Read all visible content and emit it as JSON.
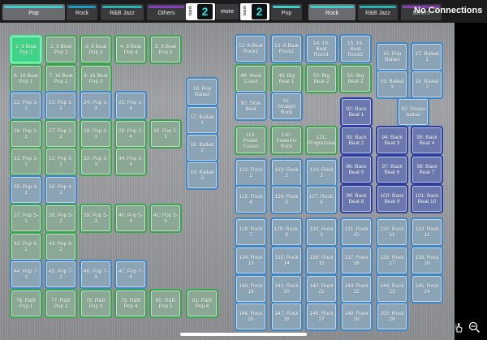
{
  "topbar": {
    "left_tabs": [
      {
        "label": "Pop",
        "active": true,
        "color": "#3bd0cc"
      },
      {
        "label": "Rock",
        "active": false,
        "color": "#1a9fc4"
      },
      {
        "label": "R&B Jazz",
        "active": false,
        "color": "#27b3b3"
      },
      {
        "label": "Others",
        "active": false,
        "color": "#8a3dbd"
      }
    ],
    "bank_left": {
      "label": "bank",
      "number": "2"
    },
    "more_label": "more",
    "bank_right": {
      "label": "bank",
      "number": "2"
    },
    "right_tabs": [
      {
        "label": "Pop",
        "active": false,
        "color": "#3bd0cc"
      },
      {
        "label": "Rock",
        "active": true,
        "color": "#3bd0cc"
      },
      {
        "label": "R&B Jazz",
        "active": false,
        "color": "#27b3b3"
      },
      {
        "label": "Others",
        "active": false,
        "color": "#8a3dbd"
      }
    ],
    "status": "No Connections"
  },
  "icons": {
    "gesture": "hand-pointer-icon",
    "zoom": "zoom-out-icon"
  },
  "colors": {
    "green": "#35a74a",
    "blue": "#3d86c8",
    "navy": "#2c3ea4",
    "selected": "#3ed387"
  },
  "left_pads": [
    {
      "label": "1: 8 Beat Pop 1",
      "tone": "sel"
    },
    {
      "label": "2: 8 Beat Pop 2",
      "tone": "g"
    },
    {
      "label": "3: 8 Beat Pop 3",
      "tone": "g"
    },
    {
      "label": "4: 8 Beat Pop 4",
      "tone": "g"
    },
    {
      "label": "5: 8 Beat Pop 5",
      "tone": "g"
    },
    {
      "label": "6: 16 Beat Pop 1",
      "tone": "g"
    },
    {
      "label": "7: 16 Beat Pop 2",
      "tone": "g"
    },
    {
      "label": "8: 16 Beat Pop 3",
      "tone": "g"
    },
    {
      "label": "18: Pop Ballad",
      "tone": "b"
    },
    {
      "label": "22: Pop 1-1",
      "tone": "b"
    },
    {
      "label": "23: Pop 1-2",
      "tone": "b"
    },
    {
      "label": "24: Pop 1-3",
      "tone": "b"
    },
    {
      "label": "25: Pop 1-4",
      "tone": "b"
    },
    {
      "label": "17: Ballad 1",
      "tone": "b"
    },
    {
      "label": "26: Pop 2-1",
      "tone": "g"
    },
    {
      "label": "27: Pop 2-2",
      "tone": "g"
    },
    {
      "label": "28: Pop 2-3",
      "tone": "g"
    },
    {
      "label": "29: Pop 2-4",
      "tone": "g"
    },
    {
      "label": "30: Pop 2-5",
      "tone": "g"
    },
    {
      "label": "18: Ballad 2",
      "tone": "b"
    },
    {
      "label": "31: Pop 3-1",
      "tone": "g"
    },
    {
      "label": "32: Pop 3-2",
      "tone": "g"
    },
    {
      "label": "33: Pop 3-3",
      "tone": "g"
    },
    {
      "label": "34: Pop 3-4",
      "tone": "g"
    },
    {
      "label": "19: Ballad 3",
      "tone": "b"
    },
    {
      "label": "35: Pop 4-1",
      "tone": "b"
    },
    {
      "label": "36: Pop 4-2",
      "tone": "b"
    },
    {
      "label": "37: Pop 5-1",
      "tone": "g"
    },
    {
      "label": "38: Pop 5-2",
      "tone": "g"
    },
    {
      "label": "39: Pop 5-3",
      "tone": "g"
    },
    {
      "label": "40: Pop 5-4",
      "tone": "g"
    },
    {
      "label": "41: Pop 5-5",
      "tone": "g"
    },
    {
      "label": "42: Pop 6-1",
      "tone": "g"
    },
    {
      "label": "43: Pop 6-2",
      "tone": "g"
    },
    {
      "label": "44: Pop 7-1",
      "tone": "b"
    },
    {
      "label": "45: Pop 7-2",
      "tone": "b"
    },
    {
      "label": "46: Pop 7-3",
      "tone": "b"
    },
    {
      "label": "47: Pop 7-4",
      "tone": "b"
    },
    {
      "label": "76: R&B Pop 1",
      "tone": "g"
    },
    {
      "label": "77: R&B Pop 2",
      "tone": "g"
    },
    {
      "label": "78: R&B Pop 3",
      "tone": "g"
    },
    {
      "label": "79: R&B Pop 4",
      "tone": "g"
    },
    {
      "label": "80: R&B Pop 5",
      "tone": "g"
    },
    {
      "label": "81: R&B Pop 6",
      "tone": "g"
    }
  ],
  "right_pads": [
    {
      "label": "12: 8-Beat Rock1",
      "tone": "b"
    },
    {
      "label": "13: 8-Beat Rock2",
      "tone": "b"
    },
    {
      "label": "14: 16-Beat Rock1",
      "tone": "b"
    },
    {
      "label": "15: 16-Beat Rock2",
      "tone": "b"
    },
    {
      "label": "16: Pop Ballad",
      "tone": "b"
    },
    {
      "label": "17: Ballad 1",
      "tone": "b"
    },
    {
      "label": "48: West Coast",
      "tone": "g"
    },
    {
      "label": "49: Big Beat 1",
      "tone": "g"
    },
    {
      "label": "50: Big Beat 2",
      "tone": "g"
    },
    {
      "label": "51: Big Beat 3",
      "tone": "g"
    },
    {
      "label": "19: Ballad 3",
      "tone": "b"
    },
    {
      "label": "18: Ballad 2",
      "tone": "b"
    },
    {
      "label": "90: Slow Beat",
      "tone": "b"
    },
    {
      "label": "91: Straight Rock",
      "tone": "b"
    },
    {
      "label": "92: Back Beat 1",
      "tone": "n"
    },
    {
      "label": "82: Rocka ballad",
      "tone": "b"
    },
    {
      "label": "119: Power Fusion",
      "tone": "g"
    },
    {
      "label": "120: Powerful Rock",
      "tone": "g"
    },
    {
      "label": "121: Progressive",
      "tone": "g"
    },
    {
      "label": "93: Back Beat 2",
      "tone": "n"
    },
    {
      "label": "94: Back Beat 3",
      "tone": "n"
    },
    {
      "label": "95: Back Beat 4",
      "tone": "n"
    },
    {
      "label": "122: Rock 1",
      "tone": "b"
    },
    {
      "label": "123: Rock 2",
      "tone": "b"
    },
    {
      "label": "124: Rock 3",
      "tone": "b"
    },
    {
      "label": "96: Back Beat 5",
      "tone": "n"
    },
    {
      "label": "97: Back Beat 6",
      "tone": "n"
    },
    {
      "label": "98: Back Beat 7",
      "tone": "n"
    },
    {
      "label": "125: Rock 4",
      "tone": "b"
    },
    {
      "label": "126: Rock 5",
      "tone": "b"
    },
    {
      "label": "127: Rock. 6",
      "tone": "b"
    },
    {
      "label": "99: Back Beat 8",
      "tone": "n"
    },
    {
      "label": "100: Back Beat 9",
      "tone": "n"
    },
    {
      "label": "101: Back Beat 10",
      "tone": "n"
    },
    {
      "label": "128: Rock 7",
      "tone": "b"
    },
    {
      "label": "129: Rock. 8",
      "tone": "b"
    },
    {
      "label": "130: Rock 9",
      "tone": "b"
    },
    {
      "label": "131: Rock 10",
      "tone": "b"
    },
    {
      "label": "132: Rock 11",
      "tone": "b"
    },
    {
      "label": "133: Rock 12",
      "tone": "b"
    },
    {
      "label": "134: Rock 13",
      "tone": "b"
    },
    {
      "label": "135: Rock 14",
      "tone": "b"
    },
    {
      "label": "136: Rock 15",
      "tone": "b"
    },
    {
      "label": "137: Rock 16",
      "tone": "b"
    },
    {
      "label": "138: Rock 17",
      "tone": "b"
    },
    {
      "label": "139: Rock 18",
      "tone": "b"
    },
    {
      "label": "140: Rock 19",
      "tone": "b"
    },
    {
      "label": "141: Rock 20",
      "tone": "b"
    },
    {
      "label": "142: Rock 21",
      "tone": "b"
    },
    {
      "label": "143: Rock 22",
      "tone": "b"
    },
    {
      "label": "144: Rock 23",
      "tone": "b"
    },
    {
      "label": "145: Rock 24",
      "tone": "b"
    },
    {
      "label": "146: Rock 25",
      "tone": "b"
    },
    {
      "label": "147: Rock 26",
      "tone": "b"
    },
    {
      "label": "148: Rock 27",
      "tone": "b"
    },
    {
      "label": "149: Rock 28",
      "tone": "b"
    },
    {
      "label": "150: Rock 29",
      "tone": "b"
    }
  ]
}
